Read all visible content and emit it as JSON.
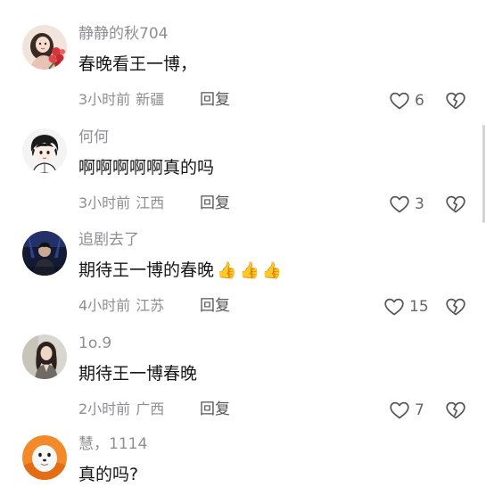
{
  "comments": [
    {
      "username": "静静的秋704",
      "text": "春晚看王一博，",
      "thumbs": [],
      "time": "3小时前",
      "location": "新疆",
      "reply_label": "回复",
      "like_count": "6",
      "avatar_icon": "girl-with-flowers-avatar"
    },
    {
      "username": "何何",
      "text": "啊啊啊啊啊真的吗",
      "thumbs": [],
      "time": "3小时前",
      "location": "江西",
      "reply_label": "回复",
      "like_count": "3",
      "avatar_icon": "cartoon-boy-avatar"
    },
    {
      "username": "追剧去了",
      "text": "期待王一博的春晚",
      "thumbs": [
        "👍",
        "👍",
        "👍"
      ],
      "time": "4小时前",
      "location": "江苏",
      "reply_label": "回复",
      "like_count": "15",
      "avatar_icon": "concert-photo-avatar"
    },
    {
      "username": "1o.9",
      "text": "期待王一博春晚",
      "thumbs": [],
      "time": "2小时前",
      "location": "广西",
      "reply_label": "回复",
      "like_count": "7",
      "avatar_icon": "girl-photo-avatar"
    },
    {
      "username": "慧，1114",
      "text": "真的吗?",
      "thumbs": [],
      "time": "",
      "location": "",
      "reply_label": "",
      "like_count": "",
      "avatar_icon": "seal-avatar"
    }
  ],
  "colors": {
    "username": "#8e8e93",
    "comment_text": "#161616",
    "meta": "#8e8e93",
    "icon_stroke": "#555555",
    "background": "#ffffff"
  },
  "icons": {
    "like": "heart-outline-icon",
    "dislike": "broken-heart-icon"
  }
}
